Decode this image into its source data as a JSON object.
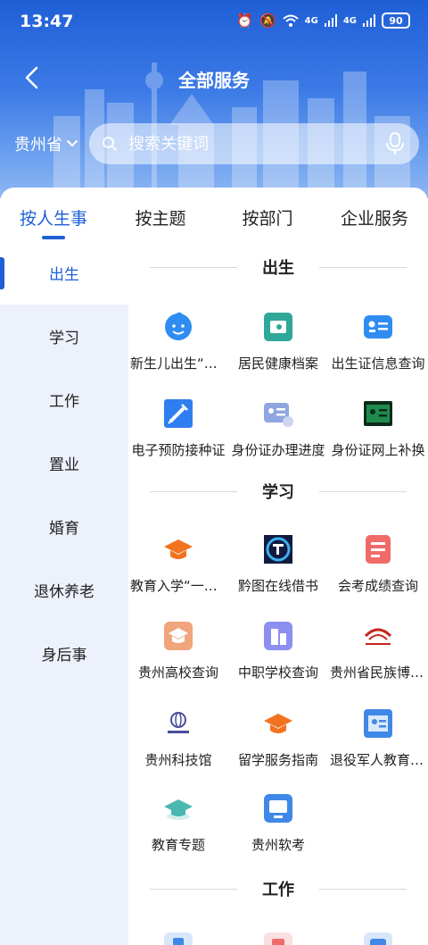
{
  "status": {
    "time": "13:47",
    "network": "4G",
    "network2": "4G",
    "battery": "90"
  },
  "header": {
    "title": "全部服务",
    "region": "贵州省",
    "search_placeholder": "搜索关键词"
  },
  "tabs": [
    {
      "label": "按人生事",
      "active": true
    },
    {
      "label": "按主题",
      "active": false
    },
    {
      "label": "按部门",
      "active": false
    },
    {
      "label": "企业服务",
      "active": false
    }
  ],
  "categories": [
    {
      "label": "出生",
      "active": true
    },
    {
      "label": "学习",
      "active": false
    },
    {
      "label": "工作",
      "active": false
    },
    {
      "label": "置业",
      "active": false
    },
    {
      "label": "婚育",
      "active": false
    },
    {
      "label": "退休养老",
      "active": false
    },
    {
      "label": "身后事",
      "active": false
    }
  ],
  "sections": [
    {
      "title": "出生",
      "items": [
        {
          "label": "新生儿出生“一件事”",
          "icon": "baby-icon",
          "color": "#2f8cf0"
        },
        {
          "label": "居民健康档案",
          "icon": "health-folder-icon",
          "color": "#2fa89a"
        },
        {
          "label": "出生证信息查询",
          "icon": "certificate-card-icon",
          "color": "#2f8cf0"
        },
        {
          "label": "电子预防接种证",
          "icon": "vaccine-syringe-icon",
          "color": "#2f7ef0"
        },
        {
          "label": "身份证办理进度",
          "icon": "id-card-progress-icon",
          "color": "#8fa6e0"
        },
        {
          "label": "身份证网上补换",
          "icon": "id-card-renew-icon",
          "color": "#1e8b4d"
        }
      ]
    },
    {
      "title": "学习",
      "items": [
        {
          "label": "教育入学“一件事”",
          "icon": "graduation-cap-icon",
          "color": "#f2731f"
        },
        {
          "label": "黔图在线借书",
          "icon": "library-logo-icon",
          "color": "#1a3a8c"
        },
        {
          "label": "会考成绩查询",
          "icon": "score-report-icon",
          "color": "#f06a6a"
        },
        {
          "label": "贵州高校查询",
          "icon": "college-cap-icon",
          "color": "#f0a57c"
        },
        {
          "label": "中职学校查询",
          "icon": "school-building-icon",
          "color": "#8c8ff0"
        },
        {
          "label": "贵州省民族博物馆",
          "icon": "museum-logo-icon",
          "color": "#c4251d"
        },
        {
          "label": "贵州科技馆",
          "icon": "science-museum-logo-icon",
          "color": "#4b4b9c"
        },
        {
          "label": "留学服务指南",
          "icon": "study-abroad-cap-icon",
          "color": "#f2731f"
        },
        {
          "label": "退役军人教育培训",
          "icon": "veteran-education-icon",
          "color": "#3f88e8"
        },
        {
          "label": "教育专题",
          "icon": "education-topic-icon",
          "color": "#4bb8b0"
        },
        {
          "label": "贵州软考",
          "icon": "computer-exam-icon",
          "color": "#3f88e8"
        }
      ]
    },
    {
      "title": "工作",
      "items": [
        {
          "label": "",
          "icon": "work-icon-1",
          "color": "#3f88e8"
        },
        {
          "label": "",
          "icon": "work-icon-2",
          "color": "#f06a6a"
        },
        {
          "label": "",
          "icon": "work-icon-3",
          "color": "#3f88e8"
        }
      ]
    }
  ]
}
